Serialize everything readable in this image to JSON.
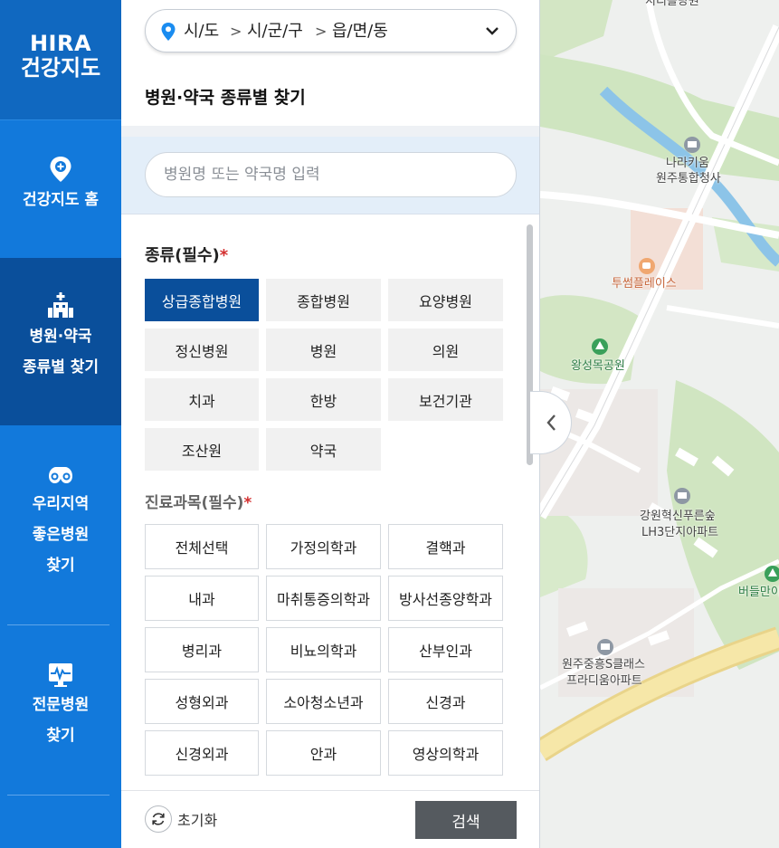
{
  "nav": {
    "logo_line1": "HIRA",
    "logo_line2": "건강지도",
    "items": [
      {
        "label": "건강지도 홈"
      },
      {
        "label_line1": "병원·약국",
        "label_line2": "종류별 찾기"
      },
      {
        "label_line1": "우리지역",
        "label_line2": "좋은병원",
        "label_line3": "찾기"
      },
      {
        "label_line1": "전문병원",
        "label_line2": "찾기"
      }
    ]
  },
  "region": {
    "sido": "시/도",
    "sigungu": "시/군/구",
    "dong": "읍/면/동",
    "separator": ">"
  },
  "panel": {
    "title": "병원·약국 종류별 찾기"
  },
  "search": {
    "placeholder": "병원명 또는 약국명 입력",
    "value": ""
  },
  "type_section": {
    "title": "종류(필수)",
    "required_mark": "*",
    "selected": "상급종합병원",
    "options": [
      "상급종합병원",
      "종합병원",
      "요양병원",
      "정신병원",
      "병원",
      "의원",
      "치과",
      "한방",
      "보건기관",
      "조산원",
      "약국"
    ]
  },
  "dept_section": {
    "title": "진료과목(필수)",
    "required_mark": "*",
    "options": [
      "전체선택",
      "가정의학과",
      "결핵과",
      "내과",
      "마취통증의학과",
      "방사선종양학과",
      "병리과",
      "비뇨의학과",
      "산부인과",
      "성형외과",
      "소아청소년과",
      "신경과",
      "신경외과",
      "안과",
      "영상의학과"
    ]
  },
  "bottom": {
    "reset_label": "초기화",
    "search_label": "검색"
  },
  "map": {
    "labels": [
      {
        "text": "지리플랑원"
      },
      {
        "text": "나라키움"
      },
      {
        "text": "원주통합청사"
      },
      {
        "text": "투썸플레이스"
      },
      {
        "text": "왕성목공원"
      },
      {
        "text": "강원혁신푸른숲"
      },
      {
        "text": "LH3단지아파트"
      },
      {
        "text": "버들만이"
      },
      {
        "text": "원주중흥S클래스"
      },
      {
        "text": "프라디움아파트"
      }
    ]
  },
  "colors": {
    "nav_bg": "#1279db",
    "nav_active": "#0a4f9b",
    "selected_btn": "#0a4f9b",
    "required": "#d32f2f",
    "search_btn": "#555a5f"
  }
}
